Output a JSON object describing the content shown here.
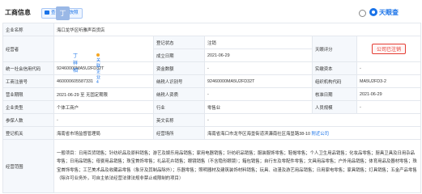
{
  "header": {
    "title": "工商信息",
    "photo_button": "查看工商快照",
    "brand_name": "天眼查"
  },
  "row1": {
    "label": "企业名称",
    "value": "海口龙华区听雅声百货店"
  },
  "row2": {
    "rep_label": "经营者",
    "rep_avatar": "丁",
    "rep_name": "丁祥相",
    "rep_relation": "关联企业 4",
    "status_label": "登记状态",
    "status_value": "注销",
    "est_label": "成立日期",
    "est_value": "2021-06-29",
    "logo_label": "天眼评分",
    "revoked_badge": "公司已注销"
  },
  "row3": {
    "credit_label": "统一社会信用代码",
    "credit_value": "92460000MA5U2FD32T",
    "capital_label": "资金数额",
    "capital_value": "-",
    "paid_label": "实缴资本",
    "paid_value": "-"
  },
  "row4": {
    "reg_label": "工商注册号",
    "reg_value": "460000605587331",
    "taxpayer_label": "纳税人识别号",
    "taxpayer_value": "92460000MA5U2FD32T",
    "org_label": "组织机构代码",
    "org_value": "MA5U2FD3-2"
  },
  "row5": {
    "term_label": "营业期限",
    "term_value": "2021-06-29 至 无固定期限",
    "qual_label": "纳税人资质",
    "qual_value": "-",
    "approve_label": "核准日期",
    "approve_value": "2021-06-29"
  },
  "row6": {
    "type_label": "企业类型",
    "type_value": "个体工商户",
    "industry_label": "行业",
    "industry_value": "零售业",
    "staff_label": "人员规模",
    "staff_value": "-"
  },
  "row7": {
    "insured_label": "参保人数",
    "insured_value": "-",
    "en_label": "英文名称",
    "en_value": "-"
  },
  "row8": {
    "authority_label": "登记机关",
    "authority_value": "海南省市场监督管理局",
    "address_label": "经营场所",
    "address_value": "海南省海口市龙华区海垦街道滨濂南社区海垦路38-10",
    "address_link": "附近公司"
  },
  "row9": {
    "scope_label": "经营范围",
    "scope_value": "一般项目：日用百货销售；针纺织品及原料销售；游艺及娱乐用品销售；家用电器销售；针纺织品销售；服装服饰零售；鞋帽零售；个人卫生用品销售；化妆品零售；厨具卫具及日用杂品零售；日用品销售；母婴用品销售；珠宝首饰零售；礼品花卉销售；眼镜销售（不含隐形眼镜）；箱包销售；自行车及零配件零售；文具用品零售；户外用品销售；体育用品及器材零售；珠宝首饰零售；工艺美术品及收藏品零售（象牙及其制品除外）；乐器零售；照明器材及建筑装饰材料销售；玩具、动漫及游艺用品销售；日用家电零售；家具销售；灯具销售；五金产品零售（除许可业务外，可自主依法经营法律法规非禁止或限制的项目）"
  }
}
